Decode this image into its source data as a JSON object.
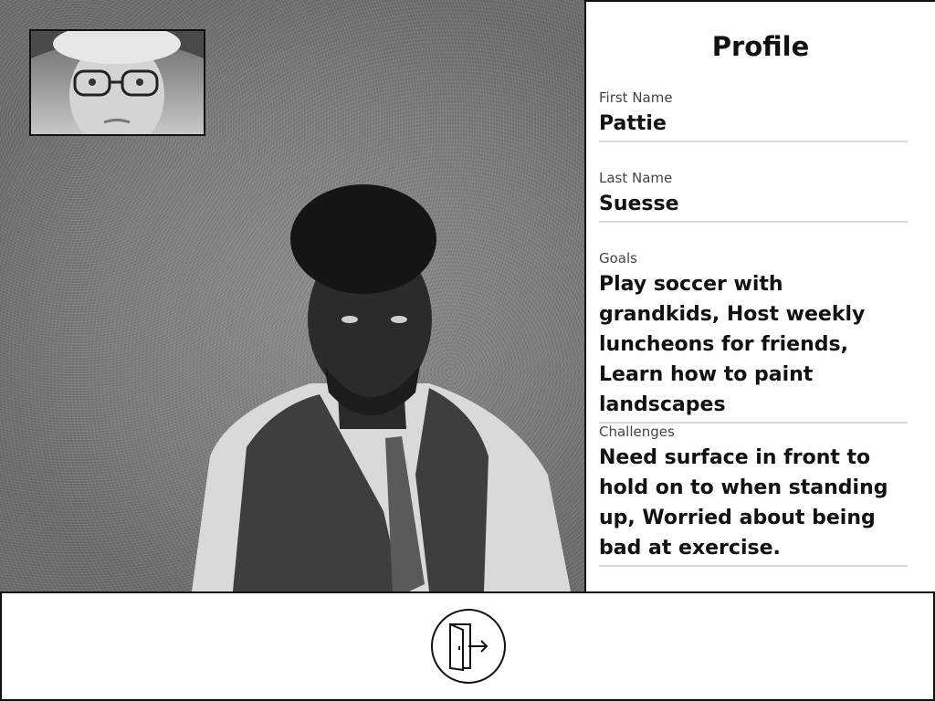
{
  "profile": {
    "title": "Profile",
    "fields": {
      "first_name": {
        "label": "First Name",
        "value": "Pattie"
      },
      "last_name": {
        "label": "Last Name",
        "value": "Suesse"
      },
      "goals": {
        "label": "Goals",
        "value": "Play soccer with grandkids, Host weekly luncheons for friends, Learn how to paint landscapes"
      },
      "challenges": {
        "label": "Challenges",
        "value": "Need surface in front to hold on to when standing up, Worried about being bad at exercise."
      }
    }
  },
  "controls": {
    "exit_icon": "exit-door-icon"
  },
  "colors": {
    "border": "#111111",
    "divider": "#d8d8d8",
    "label": "#444444"
  }
}
